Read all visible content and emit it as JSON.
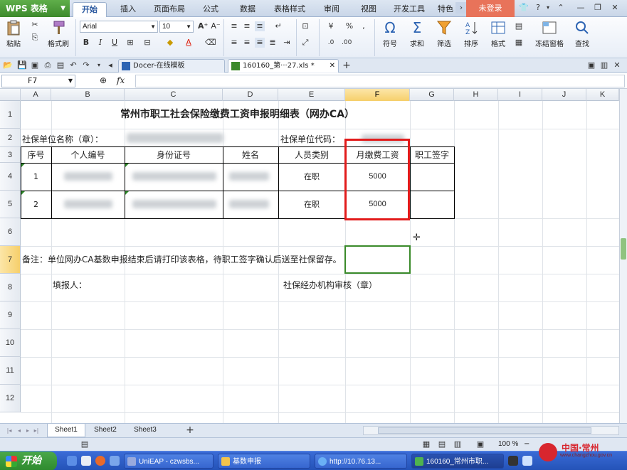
{
  "app": {
    "name": "WPS 表格",
    "login": "未登录"
  },
  "menu": [
    "开始",
    "插入",
    "页面布局",
    "公式",
    "数据",
    "表格样式",
    "审阅",
    "视图",
    "开发工具",
    "特色"
  ],
  "ribbon": {
    "paste": "粘贴",
    "format_painter": "格式刷",
    "font_name": "Arial",
    "font_size": "10",
    "symbol": "符号",
    "sum": "求和",
    "filter": "筛选",
    "sort": "排序",
    "format": "格式",
    "freeze": "冻结窗格",
    "find": "查找",
    "percent": "%"
  },
  "doc_tabs": [
    "Docer-在线模板",
    "160160_第···27.xls *"
  ],
  "formula_bar": {
    "cell_ref": "F7",
    "fx": "fx"
  },
  "columns": [
    "A",
    "B",
    "C",
    "D",
    "E",
    "F",
    "G",
    "H",
    "I",
    "J",
    "K"
  ],
  "rows": [
    "1",
    "2",
    "3",
    "4",
    "5",
    "6",
    "7",
    "8",
    "9",
    "10",
    "11",
    "12"
  ],
  "sheet": {
    "title": "常州市职工社会保险缴费工资申报明细表（网办CA）",
    "unit_name_label": "社保单位名称（章）：",
    "unit_code_label": "社保单位代码：",
    "headers": [
      "序号",
      "个人编号",
      "身份证号",
      "姓名",
      "人员类别",
      "月缴费工资",
      "职工签字"
    ],
    "data_rows": [
      {
        "seq": "1",
        "category": "在职",
        "wage": "5000"
      },
      {
        "seq": "2",
        "category": "在职",
        "wage": "5000"
      }
    ],
    "note": "备注：单位网办CA基数申报结束后请打印该表格，待职工签字确认后送至社保留存。",
    "filler": "填报人：",
    "review": "社保经办机构审核（章）"
  },
  "sheet_tabs": [
    "Sheet1",
    "Sheet2",
    "Sheet3"
  ],
  "status": {
    "zoom": "100 %"
  },
  "taskbar": {
    "start": "开始",
    "tasks": [
      "UniEAP - czwsbs...",
      "基数申报",
      "http://10.76.13...",
      "160160_常州市职..."
    ]
  },
  "watermark": {
    "text": "中国·常州",
    "url": "www.changzhou.gov.cn"
  },
  "colors": {
    "accent_green": "#3d8a2c",
    "login_red": "#e8735a",
    "red_box": "#e21b1b",
    "taskbar_blue": "#2453b8"
  }
}
